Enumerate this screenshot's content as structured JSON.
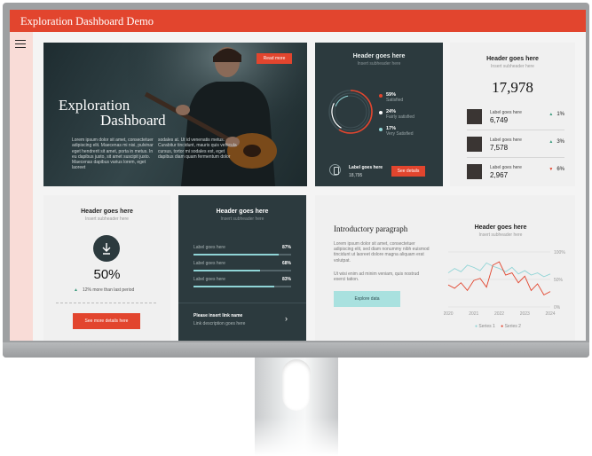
{
  "app": {
    "title": "Exploration Dashboard Demo"
  },
  "hero": {
    "title_line1": "Exploration",
    "title_line2": "Dashboard",
    "para1": "Lorem ipsum dolor sit amet, consectetuer adipiscing elit. Maecenas mi nisi, pulvinar eget hendrerit sit amet, porta in metus. In eu dapibus justo, sit amet suscipit justo. Maecenas dapibus varius lorem, eget laoreet",
    "para2": "sodales at. Ut id venenatis metus. Curabitur tincidunt, mauris quis vehicula cursus, tortor mi sodales est, eget dapibus diam quam fermentum dolor",
    "read_more": "Read more"
  },
  "satisfaction": {
    "header": "Header goes here",
    "subheader": "Insert subheader here",
    "items": [
      {
        "value": "59%",
        "label": "Satisfied",
        "color": "#e2452e"
      },
      {
        "value": "24%",
        "label": "Fairly satisfied",
        "color": "#ffffff"
      },
      {
        "value": "17%",
        "label": "Very Satisfied",
        "color": "#8fd4d6"
      }
    ],
    "stat_label": "Label goes here",
    "stat_value": "18,795",
    "see_details": "See details"
  },
  "people": {
    "header": "Header goes here",
    "subheader": "Insert subheader here",
    "total": "17,978",
    "items": [
      {
        "label": "Label goes here",
        "value": "6,749",
        "change": "1%",
        "direction": "up"
      },
      {
        "label": "Label goes here",
        "value": "7,578",
        "change": "3%",
        "direction": "up"
      },
      {
        "label": "Label goes here",
        "value": "2,967",
        "change": "6%",
        "direction": "down"
      }
    ]
  },
  "percent": {
    "header": "Header goes here",
    "subheader": "Insert subheader here",
    "value": "50%",
    "note": "12% more than last period",
    "button": "See more details here"
  },
  "progress": {
    "header": "Header goes here",
    "subheader": "Insert subheader here",
    "rows": [
      {
        "label": "Label goes here",
        "value": "87%",
        "fraction": 0.87
      },
      {
        "label": "Label goes here",
        "value": "68%",
        "fraction": 0.68
      },
      {
        "label": "Label goes here",
        "value": "83%",
        "fraction": 0.83
      }
    ],
    "link_name": "Please insert link name",
    "link_desc": "Link description goes here"
  },
  "intro": {
    "title": "Introductory paragraph",
    "para1": "Lorem ipsum dolor sit amet, consectetuer adipiscing elit, sed diam nonummy nibh euismod tincidunt ut laoreet dolore magna aliquam erat volutpat.",
    "para2": "Ut wisi enim ad minim veniam, quis nostrud exerci tation.",
    "button": "Explore data"
  },
  "chart": {
    "header": "Header goes here",
    "subheader": "Insert subheader here"
  },
  "chart_data": {
    "type": "line",
    "x": [
      2020,
      2020.25,
      2020.5,
      2020.75,
      2021,
      2021.25,
      2021.5,
      2021.75,
      2022,
      2022.25,
      2022.5,
      2022.75,
      2023,
      2023.25,
      2023.5,
      2023.75,
      2024
    ],
    "x_ticks": [
      "2020",
      "2021",
      "2022",
      "2023",
      "2024"
    ],
    "y_ticks": [
      "100%",
      "50%",
      "0%"
    ],
    "ylim": [
      0,
      100
    ],
    "grid": true,
    "legend": "bottom",
    "series": [
      {
        "name": "Series 1",
        "color": "#8fd4d6",
        "values": [
          62,
          70,
          64,
          76,
          72,
          66,
          80,
          74,
          70,
          64,
          72,
          60,
          66,
          58,
          62,
          55,
          60
        ]
      },
      {
        "name": "Series 2",
        "color": "#e2452e",
        "values": [
          40,
          34,
          44,
          30,
          48,
          52,
          36,
          76,
          82,
          58,
          62,
          44,
          56,
          30,
          42,
          22,
          28
        ]
      }
    ]
  }
}
